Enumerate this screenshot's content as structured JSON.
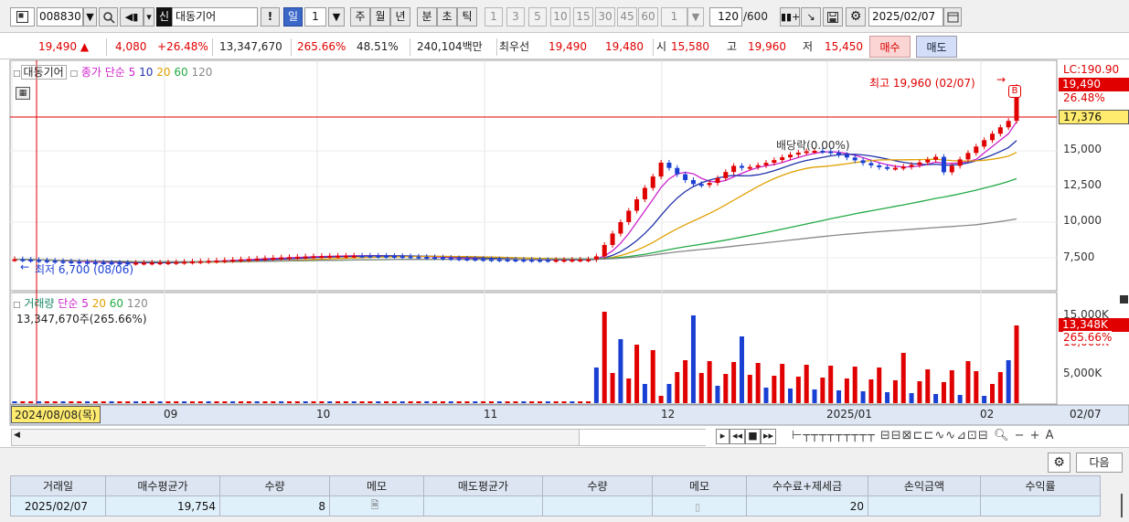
{
  "toolbar": {
    "code": "008830",
    "name_badge": "신",
    "name": "대동기어",
    "period_day": "일",
    "period_num": "1",
    "periods": [
      "주",
      "월",
      "년",
      "분",
      "초",
      "틱"
    ],
    "intervals": [
      "1",
      "3",
      "5",
      "10",
      "15",
      "30",
      "45",
      "60"
    ],
    "interval_input": "1",
    "count": "120",
    "count_max": "/600",
    "date": "2025/02/07"
  },
  "quote": {
    "price": "19,490",
    "change": "4,080",
    "change_pct": "+26.48%",
    "volume": "13,347,670",
    "vol_ratio": "265.66%",
    "turnover": "48.51%",
    "amount": "240,104백만",
    "best_label": "최우선",
    "best_ask": "19,490",
    "best_bid": "19,480",
    "open_label": "시",
    "open": "15,580",
    "high_label": "고",
    "high": "19,960",
    "low_label": "저",
    "low": "15,450",
    "buy_label": "매수",
    "sell_label": "매도"
  },
  "colors": {
    "up": "#e00000",
    "down": "#1a3fd3",
    "ma5": "#cc22cc",
    "ma10": "#2233aa",
    "ma20": "#e0a000",
    "ma60": "#22aa44",
    "ma120": "#888888"
  },
  "price_pane": {
    "legend_name": "대동기어",
    "legend_type": "종가 단순",
    "ma": [
      "5",
      "10",
      "20",
      "60",
      "120"
    ],
    "ylabel_lc": "LC:190.90",
    "yfill_price": "19,490",
    "yfill_pct": "26.48%",
    "cursor_value": "17,376",
    "high_marker": "최고 19,960 (02/07)",
    "low_marker": "최저 6,700 (08/06)",
    "event_marker": "배당락(0.00%)",
    "b_marker": "B",
    "yticks": [
      "15,000",
      "12,500",
      "10,000",
      "7,500"
    ]
  },
  "volume_pane": {
    "legend_name": "거래량",
    "legend_type": "단순",
    "ma": [
      "5",
      "20",
      "60",
      "120"
    ],
    "current": "13,347,670주(265.66%)",
    "yticks": [
      "15,000K",
      "5,000K"
    ],
    "yfill_vol": "13,348K",
    "yfill_pct": "265.66%",
    "ytick_hidden": "10,000K"
  },
  "xaxis": {
    "cursor_date": "2024/08/08(목)",
    "labels": [
      "09",
      "10",
      "11",
      "12",
      "2025/01",
      "02",
      "02/07"
    ]
  },
  "trade_table": {
    "next_label": "다음",
    "headers": [
      "거래일",
      "매수평균가",
      "수량",
      "메모",
      "매도평균가",
      "수량",
      "메모",
      "수수료+제세금",
      "손익금액",
      "수익률"
    ],
    "rows": [
      [
        "2025/02/07",
        "19,754",
        "8",
        "",
        "",
        "",
        "",
        "20",
        "",
        ""
      ]
    ]
  }
}
